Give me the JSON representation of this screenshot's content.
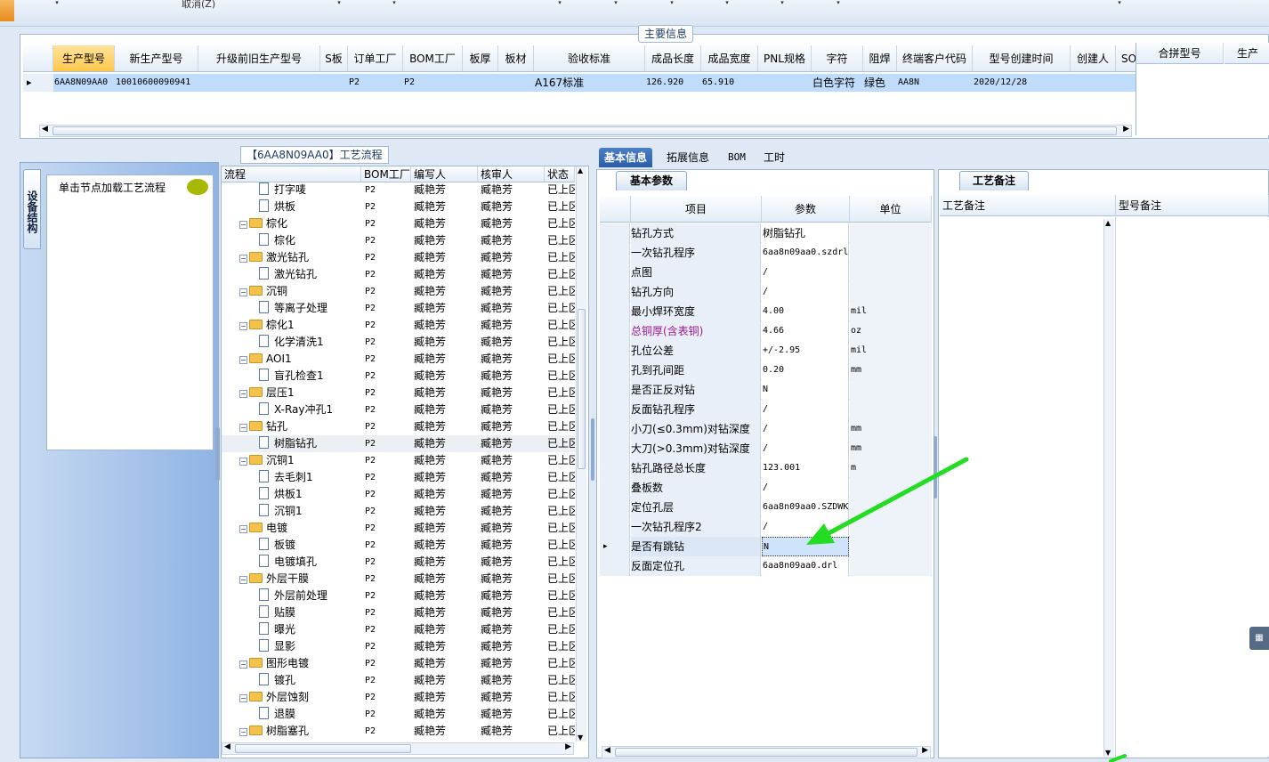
{
  "top": {
    "cancel_label": "取消(Z)"
  },
  "main_info": {
    "legend": "主要信息",
    "columns": [
      "生产型号",
      "新生产型号",
      "升级前旧生产型号",
      "S板",
      "订单工厂",
      "BOM工厂",
      "板厚",
      "板材",
      "验收标准",
      "成品长度",
      "成品宽度",
      "PNL规格",
      "字符",
      "阻焊",
      "终端客户代码",
      "型号创建时间",
      "创建人",
      "SO"
    ],
    "row": [
      "6AA8N09AA0",
      "10010600090941",
      "",
      "",
      "P2",
      "P2",
      "",
      "",
      "A167标准",
      "126.920",
      "65.910",
      "",
      "白色字符",
      "绿色",
      "AA8N",
      "2020/12/28",
      "",
      ""
    ],
    "side_columns": [
      "合拼型号",
      "生产"
    ]
  },
  "left": {
    "vertical_tab": "设备结构",
    "hint": "单击节点加载工艺流程"
  },
  "process": {
    "legend": "【6AA8N09AA0】工艺流程",
    "columns": [
      "流程",
      "BOM工厂",
      "编写人",
      "核审人",
      "状态"
    ],
    "rows": [
      {
        "name": "打字唛",
        "type": "doc",
        "bom": "P2",
        "writer": "臧艳芳",
        "reviewer": "臧艳芳",
        "status": "已上区"
      },
      {
        "name": "烘板",
        "type": "doc",
        "bom": "P2",
        "writer": "臧艳芳",
        "reviewer": "臧艳芳",
        "status": "已上区"
      },
      {
        "name": "棕化",
        "type": "folder",
        "bom": "P2",
        "writer": "臧艳芳",
        "reviewer": "臧艳芳",
        "status": "已上区"
      },
      {
        "name": "棕化",
        "type": "doc",
        "bom": "P2",
        "writer": "臧艳芳",
        "reviewer": "臧艳芳",
        "status": "已上区"
      },
      {
        "name": "激光钻孔",
        "type": "folder",
        "bom": "P2",
        "writer": "臧艳芳",
        "reviewer": "臧艳芳",
        "status": "已上区"
      },
      {
        "name": "激光钻孔",
        "type": "doc",
        "bom": "P2",
        "writer": "臧艳芳",
        "reviewer": "臧艳芳",
        "status": "已上区"
      },
      {
        "name": "沉铜",
        "type": "folder",
        "bom": "P2",
        "writer": "臧艳芳",
        "reviewer": "臧艳芳",
        "status": "已上区"
      },
      {
        "name": "等离子处理",
        "type": "doc",
        "bom": "P2",
        "writer": "臧艳芳",
        "reviewer": "臧艳芳",
        "status": "已上区"
      },
      {
        "name": "棕化1",
        "type": "folder",
        "bom": "P2",
        "writer": "臧艳芳",
        "reviewer": "臧艳芳",
        "status": "已上区"
      },
      {
        "name": "化学清洗1",
        "type": "doc",
        "bom": "P2",
        "writer": "臧艳芳",
        "reviewer": "臧艳芳",
        "status": "已上区"
      },
      {
        "name": "AOI1",
        "type": "folder",
        "bom": "P2",
        "writer": "臧艳芳",
        "reviewer": "臧艳芳",
        "status": "已上区"
      },
      {
        "name": "盲孔检查1",
        "type": "doc",
        "bom": "P2",
        "writer": "臧艳芳",
        "reviewer": "臧艳芳",
        "status": "已上区"
      },
      {
        "name": "层压1",
        "type": "folder",
        "bom": "P2",
        "writer": "臧艳芳",
        "reviewer": "臧艳芳",
        "status": "已上区"
      },
      {
        "name": "X-Ray冲孔1",
        "type": "doc",
        "bom": "P2",
        "writer": "臧艳芳",
        "reviewer": "臧艳芳",
        "status": "已上区"
      },
      {
        "name": "钻孔",
        "type": "folder",
        "bom": "P2",
        "writer": "臧艳芳",
        "reviewer": "臧艳芳",
        "status": "已上区"
      },
      {
        "name": "树脂钻孔",
        "type": "doc",
        "bom": "P2",
        "writer": "臧艳芳",
        "reviewer": "臧艳芳",
        "status": "已上区",
        "highlight": true
      },
      {
        "name": "沉铜1",
        "type": "folder",
        "bom": "P2",
        "writer": "臧艳芳",
        "reviewer": "臧艳芳",
        "status": "已上区"
      },
      {
        "name": "去毛刺1",
        "type": "doc",
        "bom": "P2",
        "writer": "臧艳芳",
        "reviewer": "臧艳芳",
        "status": "已上区"
      },
      {
        "name": "烘板1",
        "type": "doc",
        "bom": "P2",
        "writer": "臧艳芳",
        "reviewer": "臧艳芳",
        "status": "已上区"
      },
      {
        "name": "沉铜1",
        "type": "doc",
        "bom": "P2",
        "writer": "臧艳芳",
        "reviewer": "臧艳芳",
        "status": "已上区"
      },
      {
        "name": "电镀",
        "type": "folder",
        "bom": "P2",
        "writer": "臧艳芳",
        "reviewer": "臧艳芳",
        "status": "已上区"
      },
      {
        "name": "板镀",
        "type": "doc",
        "bom": "P2",
        "writer": "臧艳芳",
        "reviewer": "臧艳芳",
        "status": "已上区"
      },
      {
        "name": "电镀填孔",
        "type": "doc",
        "bom": "P2",
        "writer": "臧艳芳",
        "reviewer": "臧艳芳",
        "status": "已上区"
      },
      {
        "name": "外层干膜",
        "type": "folder",
        "bom": "P2",
        "writer": "臧艳芳",
        "reviewer": "臧艳芳",
        "status": "已上区"
      },
      {
        "name": "外层前处理",
        "type": "doc",
        "bom": "P2",
        "writer": "臧艳芳",
        "reviewer": "臧艳芳",
        "status": "已上区"
      },
      {
        "name": "贴膜",
        "type": "doc",
        "bom": "P2",
        "writer": "臧艳芳",
        "reviewer": "臧艳芳",
        "status": "已上区"
      },
      {
        "name": "曝光",
        "type": "doc",
        "bom": "P2",
        "writer": "臧艳芳",
        "reviewer": "臧艳芳",
        "status": "已上区"
      },
      {
        "name": "显影",
        "type": "doc",
        "bom": "P2",
        "writer": "臧艳芳",
        "reviewer": "臧艳芳",
        "status": "已上区"
      },
      {
        "name": "图形电镀",
        "type": "folder",
        "bom": "P2",
        "writer": "臧艳芳",
        "reviewer": "臧艳芳",
        "status": "已上区"
      },
      {
        "name": "镀孔",
        "type": "doc",
        "bom": "P2",
        "writer": "臧艳芳",
        "reviewer": "臧艳芳",
        "status": "已上区"
      },
      {
        "name": "外层蚀刻",
        "type": "folder",
        "bom": "P2",
        "writer": "臧艳芳",
        "reviewer": "臧艳芳",
        "status": "已上区"
      },
      {
        "name": "退膜",
        "type": "doc",
        "bom": "P2",
        "writer": "臧艳芳",
        "reviewer": "臧艳芳",
        "status": "已上区"
      },
      {
        "name": "树脂塞孔",
        "type": "folder",
        "bom": "P2",
        "writer": "臧艳芳",
        "reviewer": "臧艳芳",
        "status": "已上区"
      }
    ]
  },
  "tabs": [
    "基本信息",
    "拓展信息",
    "BOM",
    "工时"
  ],
  "basic": {
    "tab": "基本参数",
    "columns": [
      "项目",
      "参数",
      "单位"
    ],
    "rows": [
      {
        "k": "钻孔方式",
        "v": "树脂钻孔",
        "u": "",
        "cn": true
      },
      {
        "k": "一次钻孔程序",
        "v": "6aa8n09aa0.szdrl",
        "u": ""
      },
      {
        "k": "点图",
        "v": "/",
        "u": ""
      },
      {
        "k": "钻孔方向",
        "v": "/",
        "u": ""
      },
      {
        "k": "最小焊环宽度",
        "v": "4.00",
        "u": "mil"
      },
      {
        "k": "总铜厚(含表铜)",
        "v": "4.66",
        "u": "oz",
        "color": "#9b1b8e"
      },
      {
        "k": "孔位公差",
        "v": "+/-2.95",
        "u": "mil"
      },
      {
        "k": "孔到孔间距",
        "v": "0.20",
        "u": "mm"
      },
      {
        "k": "是否正反对钻",
        "v": "N",
        "u": ""
      },
      {
        "k": "反面钻孔程序",
        "v": "/",
        "u": ""
      },
      {
        "k": "小刀(≤0.3mm)对钻深度",
        "v": "/",
        "u": "mm"
      },
      {
        "k": "大刀(>0.3mm)对钻深度",
        "v": "/",
        "u": "mm"
      },
      {
        "k": "钻孔路径总长度",
        "v": "123.001",
        "u": "m"
      },
      {
        "k": "叠板数",
        "v": "/",
        "u": ""
      },
      {
        "k": "定位孔层",
        "v": "6aa8n09aa0.SZDWK",
        "u": ""
      },
      {
        "k": "一次钻孔程序2",
        "v": "/",
        "u": ""
      },
      {
        "k": "是否有跳钻",
        "v": "N",
        "u": "",
        "selected": true
      },
      {
        "k": "反面定位孔",
        "v": "6aa8n09aa0.drl",
        "u": ""
      }
    ]
  },
  "notes": {
    "tab": "工艺备注",
    "col1": "工艺备注",
    "col2": "型号备注"
  },
  "colors": {
    "accent": "#2b5ea8",
    "arrow": "#22dd22",
    "selected_row": "#bfdcfb",
    "header_sel": "#ffc84a"
  }
}
